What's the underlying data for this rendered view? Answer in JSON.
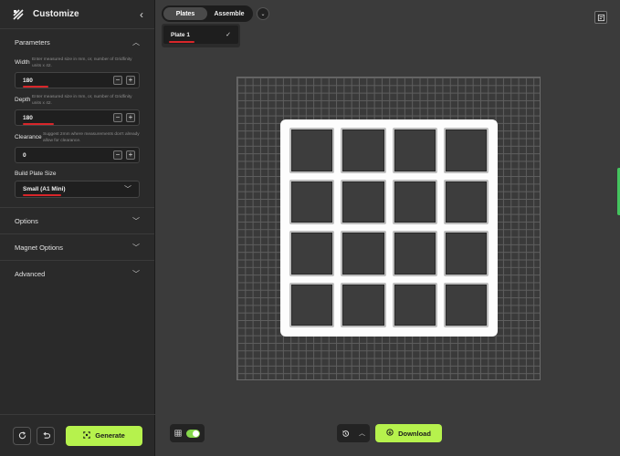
{
  "app": {
    "title": "Customize"
  },
  "parameters": {
    "heading": "Parameters",
    "width": {
      "label": "Width",
      "hint": "Enter measured size in mm, or, number of Gridfinity units x 42.",
      "value": "180"
    },
    "depth": {
      "label": "Depth",
      "hint": "Enter measured size in mm, or, number of Gridfinity units x 42.",
      "value": "180"
    },
    "clearance": {
      "label": "Clearance",
      "hint": "Suggest 2mm where measurements don't already allow for clearance.",
      "value": "0"
    },
    "build_plate": {
      "label": "Build Plate Size",
      "value": "Small (A1 Mini)"
    },
    "minus": "−",
    "plus": "+"
  },
  "sections": {
    "options": "Options",
    "magnet": "Magnet Options",
    "advanced": "Advanced"
  },
  "footer": {
    "generate": "Generate"
  },
  "top": {
    "tabs": [
      "Plates",
      "Assemble"
    ],
    "active_tab": "Plates",
    "plate_item": "Plate 1"
  },
  "bottom": {
    "download": "Download"
  },
  "grid": {
    "columns": 4,
    "rows": 4
  },
  "colors": {
    "accent": "#b6f24d",
    "annotation": "#d8262a"
  },
  "icons": {
    "logo": "logo-icon",
    "back": "chevron-left-icon",
    "refresh": "refresh-icon",
    "undo": "undo-icon",
    "generate": "generate-icon",
    "check": "check-icon",
    "more": "chevron-double-down-icon",
    "notes": "notes-icon",
    "grid": "grid-icon",
    "history": "history-icon",
    "download": "download-icon"
  }
}
